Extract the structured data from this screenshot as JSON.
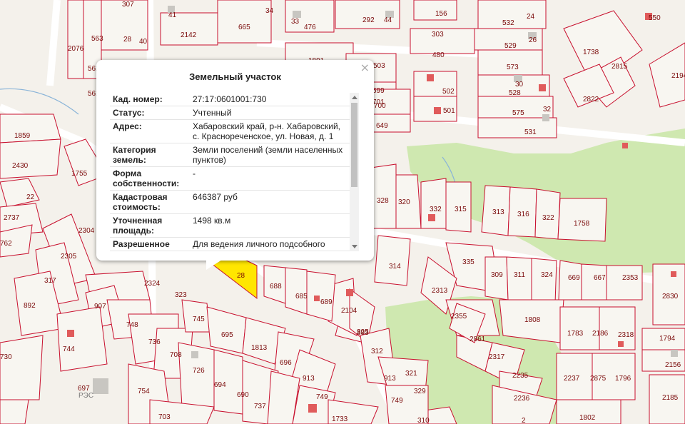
{
  "map": {
    "colors": {
      "background": "#f4f1eb",
      "parcel_fill": "#f8f6f1",
      "parcel_border": "#c8102e",
      "green": "#cfe8b0",
      "selected": "#ffe600",
      "road": "#ffffff",
      "building": "#e05b5b",
      "water": "#8ab4d8"
    },
    "parcel_labels": [
      "307",
      "665",
      "41",
      "34",
      "33",
      "476",
      "292",
      "44",
      "156",
      "532",
      "24",
      "550",
      "2142",
      "2076",
      "563",
      "28",
      "40",
      "1891",
      "303",
      "529",
      "26",
      "1738",
      "2815",
      "2194",
      "675",
      "480",
      "503",
      "562",
      "573",
      "30",
      "528",
      "2822",
      "562",
      "699",
      "502",
      "32",
      "575",
      "701",
      "501",
      "1859",
      "700",
      "649",
      "531",
      "2430",
      "1755",
      "328",
      "320",
      "332",
      "315",
      "313",
      "316",
      "322",
      "1758",
      "2737",
      "22",
      "2304",
      "762",
      "2305",
      "314",
      "335",
      "309",
      "311",
      "324",
      "669",
      "667",
      "2353",
      "2830",
      "688",
      "685",
      "689",
      "2104",
      "893",
      "2324",
      "323",
      "2313",
      "317",
      "2355",
      "1808",
      "892",
      "907",
      "748",
      "745",
      "695",
      "325",
      "2861",
      "1783",
      "2186",
      "2318",
      "1794",
      "744",
      "736",
      "708",
      "1813",
      "696",
      "312",
      "2317",
      "2156",
      "726",
      "913",
      "913",
      "321",
      "2235",
      "2237",
      "2875",
      "1796",
      "2185",
      "697",
      "694",
      "690",
      "737",
      "749",
      "749",
      "329",
      "2236",
      "1802",
      "754",
      "703",
      "1733",
      "310",
      "2",
      "730",
      "28"
    ],
    "place_label": "РЭС"
  },
  "popup": {
    "title": "Земельный участок",
    "close_label": "×",
    "rows": [
      {
        "key": "Кад. номер:",
        "value": "27:17:0601001:730"
      },
      {
        "key": "Статус:",
        "value": "Учтенный"
      },
      {
        "key": "Адрес:",
        "value": "Хабаровский край, р-н. Хабаровский, с. Краснореченское, ул. Новая, д. 1"
      },
      {
        "key": "Категория земель:",
        "value": "Земли поселений (земли населенных пунктов)"
      },
      {
        "key": "Форма собственности:",
        "value": "-"
      },
      {
        "key": "Кадастровая стоимость:",
        "value": "646387 руб"
      },
      {
        "key": "Уточненная площадь:",
        "value": "1498 кв.м"
      },
      {
        "key": "Разрешенное",
        "value": "Для ведения личного подсобного"
      }
    ]
  }
}
